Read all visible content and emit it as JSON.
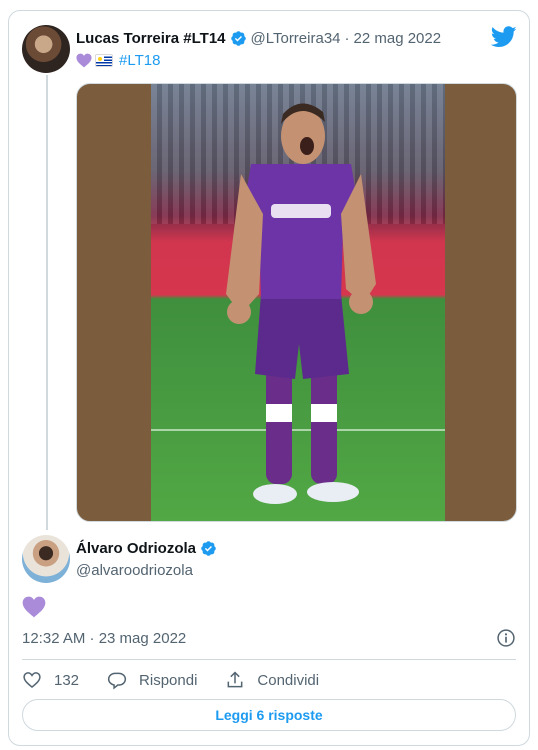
{
  "quoted_tweet": {
    "author_name": "Lucas Torreira #LT14",
    "author_handle": "@LTorreira34",
    "separator": "·",
    "date": "22 mag 2022",
    "text_hashtag": "#LT18",
    "text_emoji": [
      "purple-heart",
      "uruguay-flag"
    ],
    "media_alt": "player celebrating in purple kit number 18"
  },
  "tweet": {
    "author_name": "Álvaro Odriozola",
    "author_handle": "@alvaroodriozola",
    "text_emoji": "purple-heart",
    "timestamp": "12:32 AM · 23 mag 2022"
  },
  "actions": {
    "like_count": "132",
    "reply_label": "Rispondi",
    "share_label": "Condividi"
  },
  "read_replies_label": "Leggi 6 risposte",
  "colors": {
    "accent": "#1d9bf0",
    "verified": "#1d9bf0",
    "heart_emoji": "#a98bd9",
    "text_secondary": "#536471",
    "border": "#cfd9de"
  },
  "icons": [
    "verified-badge-icon",
    "twitter-logo-icon",
    "info-icon",
    "like-icon",
    "reply-icon",
    "share-icon"
  ]
}
